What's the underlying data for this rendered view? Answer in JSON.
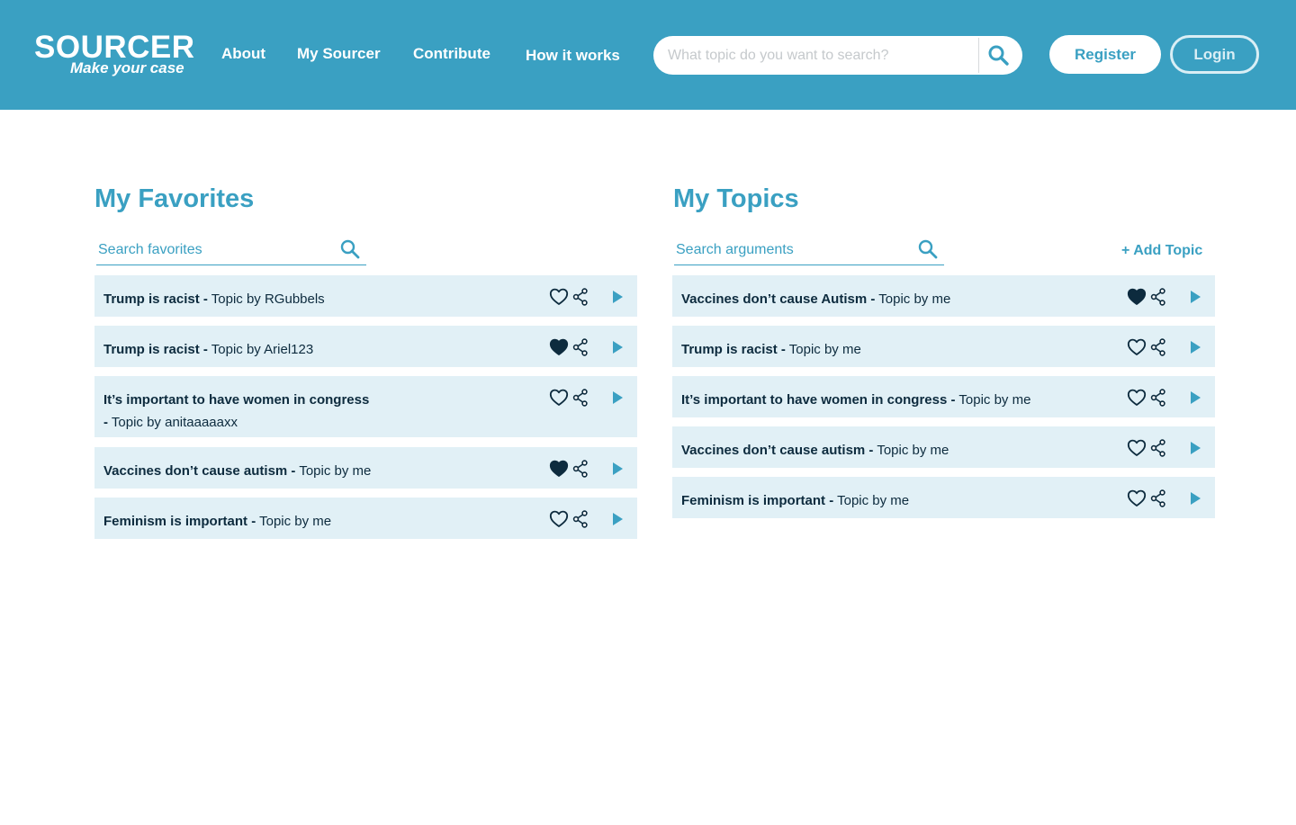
{
  "header": {
    "logo_word": "SOURCER",
    "logo_tagline": "Make your case",
    "nav": [
      {
        "label": "About"
      },
      {
        "label": "My Sourcer"
      },
      {
        "label": "Contribute"
      },
      {
        "label": "How it works"
      }
    ],
    "search": {
      "placeholder": "What topic do you want to search?",
      "value": ""
    },
    "register_label": "Register",
    "login_label": "Login"
  },
  "favorites": {
    "title": "My Favorites",
    "search_placeholder": "Search favorites",
    "items": [
      {
        "title": "Trump is racist -",
        "meta": "Topic by RGubbels",
        "favorited": false
      },
      {
        "title": "Trump is racist -",
        "meta": "Topic by Ariel123",
        "favorited": true
      },
      {
        "title": "It’s important to have women in congress",
        "title2": "-",
        "meta": "Topic by anitaaaaaxx",
        "favorited": false
      },
      {
        "title": "Vaccines don’t cause autism -",
        "meta": "Topic by me",
        "favorited": true
      },
      {
        "title": "Feminism is important -",
        "meta": "Topic by me",
        "favorited": false
      }
    ]
  },
  "topics": {
    "title": "My Topics",
    "search_placeholder": "Search arguments",
    "add_label": "+ Add Topic",
    "items": [
      {
        "title": "Vaccines don’t cause Autism -",
        "meta": "Topic by me",
        "favorited": true
      },
      {
        "title": "Trump is racist -",
        "meta": "Topic by me",
        "favorited": false
      },
      {
        "title": "It’s important to have women in congress -",
        "meta": "Topic by me",
        "favorited": false
      },
      {
        "title": "Vaccines don’t cause autism -",
        "meta": "Topic by me",
        "favorited": false
      },
      {
        "title": "Feminism is important -",
        "meta": "Topic by me",
        "favorited": false
      }
    ]
  },
  "colors": {
    "brand": "#3aa0c2",
    "row_bg": "#e1f0f6",
    "text_dark": "#0d2b3e"
  },
  "icons": {
    "heart": "heart-icon",
    "share": "share-icon",
    "play": "play-icon",
    "search": "search-icon"
  }
}
